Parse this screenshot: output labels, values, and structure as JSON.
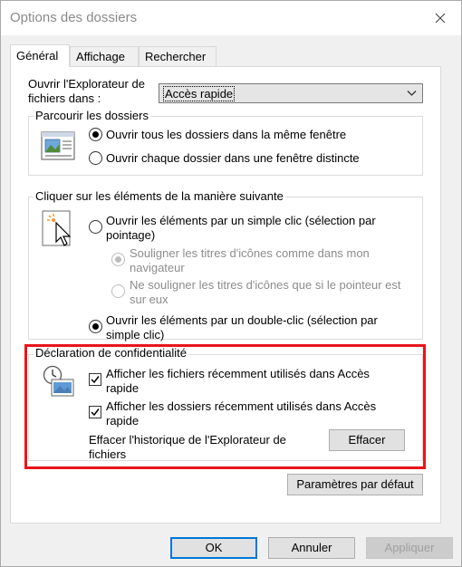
{
  "window": {
    "title": "Options des dossiers"
  },
  "tabs": [
    {
      "label": "Général",
      "active": true
    },
    {
      "label": "Affichage",
      "active": false
    },
    {
      "label": "Rechercher",
      "active": false
    }
  ],
  "open_explorer": {
    "label_line1": "Ouvrir l'Explorateur de",
    "label_line2": "fichiers dans :",
    "selected": "Accès rapide"
  },
  "browse_group": {
    "title": "Parcourir les dossiers",
    "option_same_window": "Ouvrir tous les dossiers dans la même fenêtre",
    "option_new_window": "Ouvrir chaque dossier dans une fenêtre distincte"
  },
  "click_group": {
    "title": "Cliquer sur les éléments de la manière suivante",
    "single_click_line1": "Ouvrir les éléments par un simple clic (sélection par",
    "single_click_line2": "pointage)",
    "underline_browser_line1": "Souligner les titres d'icônes comme dans mon",
    "underline_browser_line2": "navigateur",
    "underline_hover_line1": "Ne souligner les titres d'icônes que si le pointeur est",
    "underline_hover_line2": "sur eux",
    "double_click_line1": "Ouvrir les éléments par un double-clic (sélection par",
    "double_click_line2": "simple clic)"
  },
  "privacy_group": {
    "title": "Déclaration de confidentialité",
    "recent_files_line1": "Afficher les fichiers récemment utilisés dans Accès",
    "recent_files_line2": "rapide",
    "recent_folders_line1": "Afficher les dossiers récemment utilisés dans Accès",
    "recent_folders_line2": "rapide",
    "clear_history_line1": "Effacer l'historique de l'Explorateur de",
    "clear_history_line2": "fichiers",
    "clear_button": "Effacer"
  },
  "restore_defaults_button": "Paramètres par défaut",
  "footer": {
    "ok": "OK",
    "cancel": "Annuler",
    "apply": "Appliquer"
  },
  "colors": {
    "highlight": "#e8141a",
    "accent": "#0078d7"
  }
}
